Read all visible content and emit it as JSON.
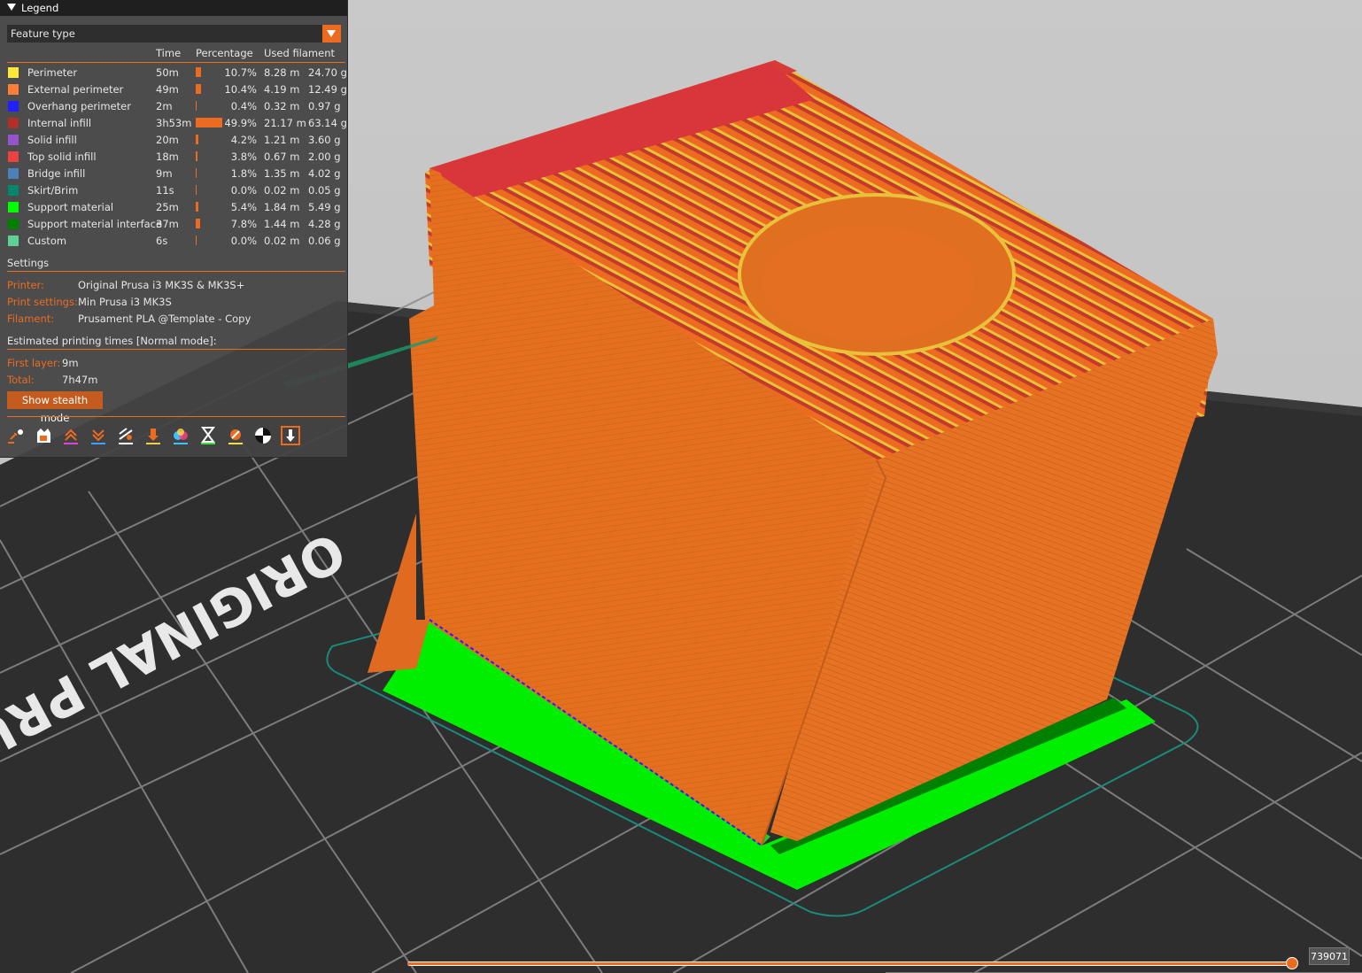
{
  "legend": {
    "title": "Legend",
    "view_type": "Feature type",
    "headers": {
      "time": "Time",
      "percentage": "Percentage",
      "used_filament": "Used filament"
    },
    "features": [
      {
        "name": "Perimeter",
        "color": "#ffe63a",
        "time": "50m",
        "percentage": "10.7%",
        "percent_value": 10.7,
        "length": "8.28 m",
        "weight": "24.70 g"
      },
      {
        "name": "External perimeter",
        "color": "#ff7d38",
        "time": "49m",
        "percentage": "10.4%",
        "percent_value": 10.4,
        "length": "4.19 m",
        "weight": "12.49 g"
      },
      {
        "name": "Overhang perimeter",
        "color": "#1f1fff",
        "time": "2m",
        "percentage": "0.4%",
        "percent_value": 0.4,
        "length": "0.32 m",
        "weight": "0.97 g"
      },
      {
        "name": "Internal infill",
        "color": "#b03029",
        "time": "3h53m",
        "percentage": "49.9%",
        "percent_value": 49.9,
        "length": "21.17 m",
        "weight": "63.14 g"
      },
      {
        "name": "Solid infill",
        "color": "#9654cc",
        "time": "20m",
        "percentage": "4.2%",
        "percent_value": 4.2,
        "length": "1.21 m",
        "weight": "3.60 g"
      },
      {
        "name": "Top solid infill",
        "color": "#f04040",
        "time": "18m",
        "percentage": "3.8%",
        "percent_value": 3.8,
        "length": "0.67 m",
        "weight": "2.00 g"
      },
      {
        "name": "Bridge infill",
        "color": "#4d80ba",
        "time": "9m",
        "percentage": "1.8%",
        "percent_value": 1.8,
        "length": "1.35 m",
        "weight": "4.02 g"
      },
      {
        "name": "Skirt/Brim",
        "color": "#00876e",
        "time": "11s",
        "percentage": "0.0%",
        "percent_value": 0.0,
        "length": "0.02 m",
        "weight": "0.05 g"
      },
      {
        "name": "Support material",
        "color": "#00ff00",
        "time": "25m",
        "percentage": "5.4%",
        "percent_value": 5.4,
        "length": "1.84 m",
        "weight": "5.49 g"
      },
      {
        "name": "Support material interface",
        "color": "#008000",
        "time": "37m",
        "percentage": "7.8%",
        "percent_value": 7.8,
        "length": "1.44 m",
        "weight": "4.28 g"
      },
      {
        "name": "Custom",
        "color": "#5ed194",
        "time": "6s",
        "percentage": "0.0%",
        "percent_value": 0.0,
        "length": "0.02 m",
        "weight": "0.06 g"
      }
    ],
    "settings_title": "Settings",
    "settings": [
      {
        "key": "Printer:",
        "value": "Original Prusa i3 MK3S & MK3S+"
      },
      {
        "key": "Print settings:",
        "value": "Min Prusa i3 MK3S"
      },
      {
        "key": "Filament:",
        "value": "Prusament PLA @Template - Copy"
      }
    ],
    "times_title": "Estimated printing times [Normal mode]:",
    "times": [
      {
        "key": "First layer:",
        "value": "9m"
      },
      {
        "key": "Total:",
        "value": "7h47m"
      }
    ],
    "stealth_button": "Show stealth mode",
    "toolbar_icons": [
      "travel-icon",
      "wipe-icon",
      "retractions-icon",
      "deretractions-icon",
      "seams-icon",
      "tool-changes-icon",
      "color-changes-icon",
      "pause-prints-icon",
      "custom-gcodes-icon",
      "center-of-gravity-icon",
      "shells-icon"
    ]
  },
  "bed_text": "ORIGINAL PRUS",
  "slider": {
    "value": "739071",
    "position_fraction": 1.0
  },
  "colors": {
    "accent": "#ed6b21",
    "bed": "#2f2f2f",
    "background": "#c8c8c8"
  }
}
